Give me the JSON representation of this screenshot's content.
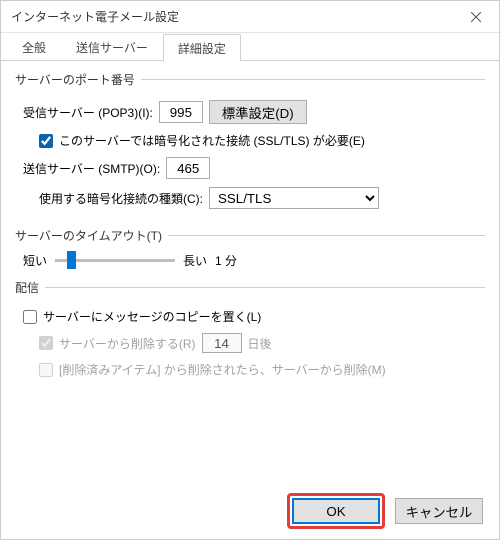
{
  "window": {
    "title": "インターネット電子メール設定"
  },
  "tabs": {
    "general": "全般",
    "outgoing": "送信サーバー",
    "advanced": "詳細設定"
  },
  "ports": {
    "legend": "サーバーのポート番号",
    "incoming_label": "受信サーバー (POP3)(I):",
    "incoming_value": "995",
    "defaults_btn": "標準設定(D)",
    "ssl_required": "このサーバーでは暗号化された接続 (SSL/TLS) が必要(E)",
    "outgoing_label": "送信サーバー (SMTP)(O):",
    "outgoing_value": "465",
    "enc_type_label": "使用する暗号化接続の種類(C):",
    "enc_type_value": "SSL/TLS"
  },
  "timeout": {
    "legend": "サーバーのタイムアウト(T)",
    "short": "短い",
    "long": "長い",
    "value": "1 分"
  },
  "delivery": {
    "legend": "配信",
    "leave_copy": "サーバーにメッセージのコピーを置く(L)",
    "remove_after": "サーバーから削除する(R)",
    "days_value": "14",
    "days_suffix": "日後",
    "remove_when_deleted": "[削除済みアイテム] から削除されたら、サーバーから削除(M)"
  },
  "buttons": {
    "ok": "OK",
    "cancel": "キャンセル"
  }
}
